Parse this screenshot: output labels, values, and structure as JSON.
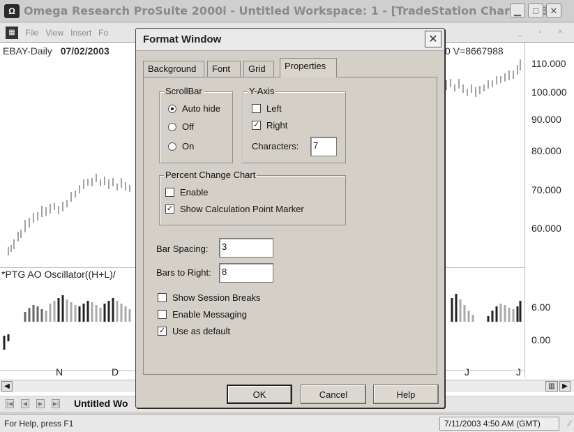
{
  "window": {
    "app_title": "Omega Research ProSuite 2000i - Untitled Workspace:  1 - [TradeStation Chart - (EB...",
    "icon": "omega-logo-icon"
  },
  "menu": {
    "items": [
      "File",
      "View",
      "Insert",
      "Fo"
    ]
  },
  "chart": {
    "symbol": "EBAY-Daily",
    "date": "07/02/2003",
    "volume_text": "0  V=8667988",
    "price_axis": [
      "110.000",
      "100.000",
      "90.000",
      "80.000",
      "70.000",
      "60.000"
    ],
    "osc_label": "*PTG AO Oscillator((H+L)/",
    "osc_axis": [
      "6.00",
      "0.00"
    ],
    "months_left": [
      "N",
      "D"
    ],
    "months_right": [
      "J",
      "J"
    ]
  },
  "workspace": {
    "tab_label": "Untitled Wo"
  },
  "status": {
    "left": "For Help, press F1",
    "right": "7/11/2003 4:50 AM (GMT)"
  },
  "dialog": {
    "title": "Format Window",
    "tabs": [
      "Background",
      "Font",
      "Grid",
      "Properties"
    ],
    "active_tab": "Properties",
    "scrollbar": {
      "label": "ScrollBar",
      "options": [
        "Auto hide",
        "Off",
        "On"
      ],
      "selected": "Auto hide"
    },
    "yaxis": {
      "label": "Y-Axis",
      "left_label": "Left",
      "left_checked": false,
      "right_label": "Right",
      "right_checked": true,
      "characters_label": "Characters:",
      "characters_value": "7"
    },
    "percent_change": {
      "label": "Percent Change Chart",
      "enable_label": "Enable",
      "enable_checked": false,
      "marker_label": "Show Calculation Point Marker",
      "marker_checked": true
    },
    "bar_spacing_label": "Bar Spacing:",
    "bar_spacing_value": "3",
    "bars_right_label": "Bars to Right:",
    "bars_right_value": "8",
    "show_session_label": "Show Session Breaks",
    "show_session_checked": false,
    "enable_messaging_label": "Enable Messaging",
    "enable_messaging_checked": false,
    "use_default_label": "Use as default",
    "use_default_checked": true,
    "ok_label": "OK",
    "cancel_label": "Cancel",
    "help_label": "Help"
  }
}
